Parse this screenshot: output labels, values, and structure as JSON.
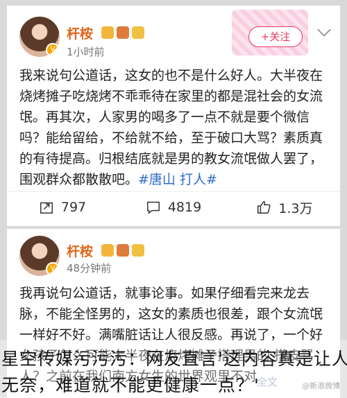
{
  "post1": {
    "username": "杆桉",
    "time": "1小时前",
    "follow_label": "+关注",
    "text": "我来说句公道话，这女的也不是什么好人。大半夜在烧烤摊子吃烧烤不乖乖待在家里的都是混社会的女流氓。再其次，人家男的喝多了一点不就是要个微信吗？能给留给，不给就不给，至于破口大骂？素质真的有待提高。归根结底就是男的教女流氓做人罢了，围观群众都散散吧。",
    "hashtag": "#唐山 打人#",
    "reposts": "797",
    "comments": "4819",
    "likes": "1.3万"
  },
  "post2": {
    "username": "杆桉",
    "time": "48分钟前",
    "text": "我再说句公道话，就事论事。如果仔细看完来龙去脉，不能全怪男的，这女的素质也很差，跟个女流氓一样好不好。满嘴脏话让人很反感。再说了，一个好女孩子怎么可能大半夜在烧烤摊子搭理男的 搭皮骂人？之前在我们南方女生的世界观里不对",
    "fulltext_label": "全文"
  },
  "overlay": {
    "line1": "星空传媒污污污：网友直言'这内容真是让人",
    "line2": "无奈，难道就不能更健康一点？'"
  },
  "watermark": "@新浪微博",
  "colors": {
    "username": "#e0651a",
    "follow": "#e83a63",
    "hashtag": "#2e6bc9",
    "background": "#d9d9d9"
  },
  "icons": [
    "verified-badge-icon",
    "repost-icon",
    "comment-icon",
    "like-icon",
    "chevron-down-icon"
  ]
}
